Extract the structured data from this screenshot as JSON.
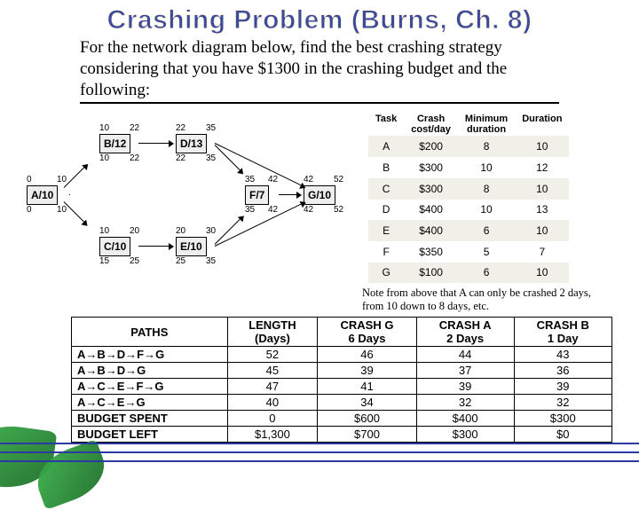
{
  "title": "Crashing Problem (Burns, Ch. 8)",
  "intro": "For the network diagram below, find the best crashing strategy considering that you have $1300 in the crashing budget and the following:",
  "diagram": {
    "nodes": {
      "A": {
        "label": "A/10",
        "tl": "0",
        "tr": "10",
        "bl": "0",
        "br": "10"
      },
      "B": {
        "label": "B/12",
        "tl": "10",
        "tr": "22",
        "bl": "10",
        "br": "22"
      },
      "C": {
        "label": "C/10",
        "tl": "10",
        "tr": "20",
        "bl": "15",
        "br": "25"
      },
      "D": {
        "label": "D/13",
        "tl": "22",
        "tr": "35",
        "bl": "22",
        "br": "35"
      },
      "E": {
        "label": "E/10",
        "tl": "20",
        "tr": "30",
        "bl": "25",
        "br": "35"
      },
      "F": {
        "label": "F/7",
        "tl": "35",
        "tr": "42",
        "bl": "35",
        "br": "42"
      },
      "G": {
        "label": "G/10",
        "tl": "42",
        "tr": "52",
        "bl": "42",
        "br": "52"
      }
    }
  },
  "task_headers": {
    "task": "Task",
    "c1": "Crash cost/day",
    "c2": "Minimum duration",
    "c3": "Duration"
  },
  "tasks": [
    {
      "t": "A",
      "c": "$200",
      "m": "8",
      "d": "10"
    },
    {
      "t": "B",
      "c": "$300",
      "m": "10",
      "d": "12"
    },
    {
      "t": "C",
      "c": "$300",
      "m": "8",
      "d": "10"
    },
    {
      "t": "D",
      "c": "$400",
      "m": "10",
      "d": "13"
    },
    {
      "t": "E",
      "c": "$400",
      "m": "6",
      "d": "10"
    },
    {
      "t": "F",
      "c": "$350",
      "m": "5",
      "d": "7"
    },
    {
      "t": "G",
      "c": "$100",
      "m": "6",
      "d": "10"
    }
  ],
  "note": "Note from above that A can only be crashed 2 days, from 10 down to 8 days, etc.",
  "paths_headers": {
    "p": "PATHS",
    "len": "LENGTH (Days)",
    "cg": "CRASH G 6 Days",
    "ca": "CRASH A 2 Days",
    "cb": "CRASH B 1 Day"
  },
  "arrow": "→",
  "paths": [
    {
      "p": [
        "A",
        "B",
        "D",
        "F",
        "G"
      ],
      "v": [
        "52",
        "46",
        "44",
        "43"
      ]
    },
    {
      "p": [
        "A",
        "B",
        "D",
        "G"
      ],
      "v": [
        "45",
        "39",
        "37",
        "36"
      ]
    },
    {
      "p": [
        "A",
        "C",
        "E",
        "F",
        "G"
      ],
      "v": [
        "47",
        "41",
        "39",
        "39"
      ]
    },
    {
      "p": [
        "A",
        "C",
        "E",
        "G"
      ],
      "v": [
        "40",
        "34",
        "32",
        "32"
      ]
    }
  ],
  "budget_rows": [
    {
      "l": "BUDGET SPENT",
      "v": [
        "0",
        "$600",
        "$400",
        "$300"
      ]
    },
    {
      "l": "BUDGET LEFT",
      "v": [
        "$1,300",
        "$700",
        "$300",
        "$0"
      ]
    }
  ]
}
